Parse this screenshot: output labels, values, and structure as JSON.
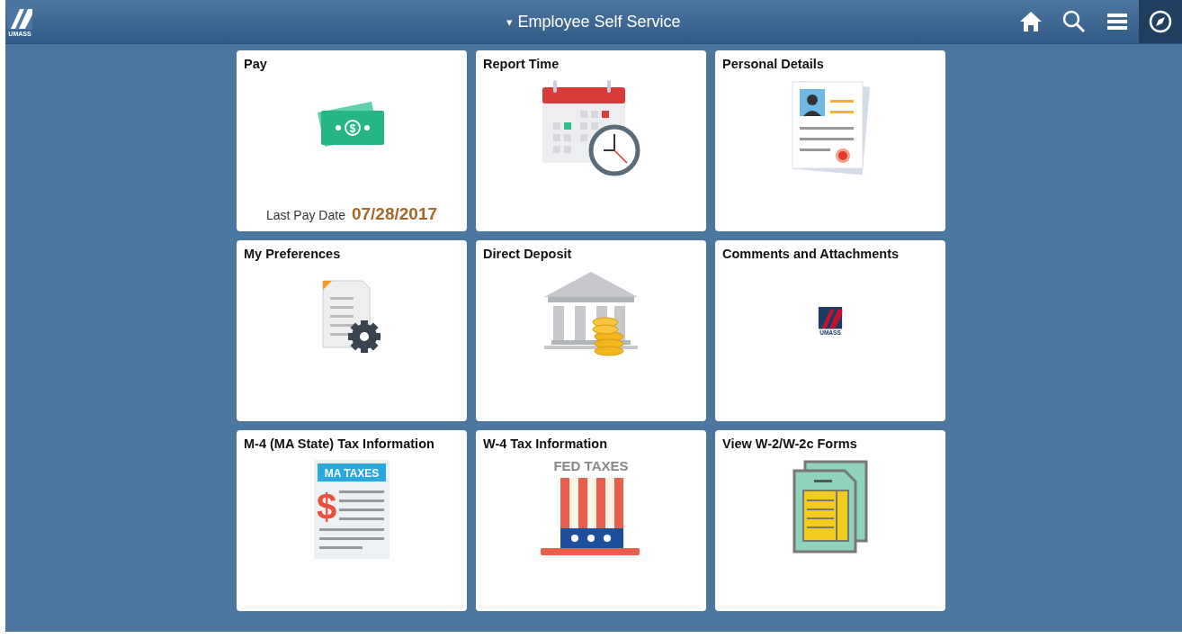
{
  "header": {
    "logo_text": "UMASS",
    "title": "Employee Self Service",
    "title_caret": "▾"
  },
  "tiles": [
    {
      "title": "Pay",
      "kind": "money",
      "icon_symbol": "$",
      "footer": {
        "label": "Last Pay Date",
        "value": "07/28/2017"
      }
    },
    {
      "title": "Report Time",
      "kind": "calendar"
    },
    {
      "title": "Personal Details",
      "kind": "profile"
    },
    {
      "title": "My Preferences",
      "kind": "preferences"
    },
    {
      "title": "Direct Deposit",
      "kind": "bank"
    },
    {
      "title": "Comments and Attachments",
      "kind": "logo",
      "icon_text": "UMASS"
    },
    {
      "title": "M-4 (MA State) Tax Information",
      "kind": "ma-tax",
      "icon_symbol": "$",
      "icon_text": "MA TAXES"
    },
    {
      "title": "W-4 Tax Information",
      "kind": "fed-tax",
      "icon_text": "FED TAXES"
    },
    {
      "title": "View W-2/W-2c Forms",
      "kind": "forms"
    }
  ]
}
